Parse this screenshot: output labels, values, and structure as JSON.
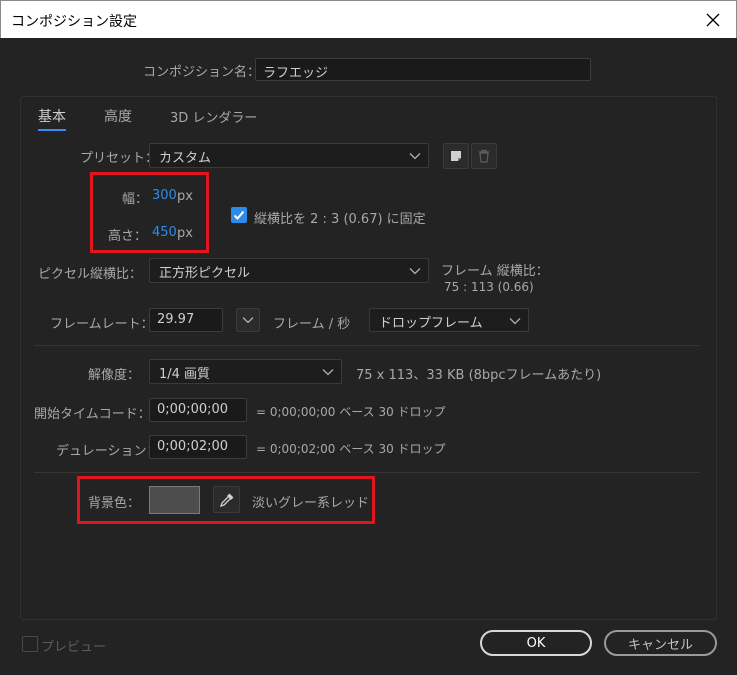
{
  "window": {
    "title": "コンポジション設定"
  },
  "comp_name": {
    "label": "コンポジション名：",
    "value": "ラフエッジ"
  },
  "tabs": [
    {
      "label": "基本",
      "active": true
    },
    {
      "label": "高度"
    },
    {
      "label": "3D レンダラー"
    }
  ],
  "preset": {
    "label": "プリセット：",
    "value": "カスタム"
  },
  "width": {
    "label": "幅：",
    "value": "300",
    "unit": "px"
  },
  "height": {
    "label": "高さ：",
    "value": "450",
    "unit": "px"
  },
  "aspect_lock": {
    "label": "縦横比を 2 : 3 (0.67) に固定",
    "checked": true
  },
  "pixel_aspect": {
    "label": "ピクセル縦横比：",
    "value": "正方形ピクセル"
  },
  "frame_aspect": {
    "label": "フレーム 縦横比：",
    "value": "75 : 113 (0.66)"
  },
  "frame_rate": {
    "label": "フレームレート：",
    "value": "29.97",
    "unit": "フレーム / 秒",
    "mode": "ドロップフレーム"
  },
  "resolution": {
    "label": "解像度：",
    "value": "1/4 画質",
    "info": "75 x 113、33 KB (8bpcフレームあたり)"
  },
  "start_timecode": {
    "label": "開始タイムコード：",
    "value": "0;00;00;00",
    "info": "= 0;00;00;00 ベース 30 ドロップ"
  },
  "duration": {
    "label": "デュレーション：",
    "value": "0;00;02;00",
    "info": "= 0;00;02;00 ベース 30 ドロップ"
  },
  "background": {
    "label": "背景色：",
    "color": "#4d4d4d",
    "name": "淡いグレー系レッド"
  },
  "preview": {
    "label": "プレビュー"
  },
  "buttons": {
    "ok": "OK",
    "cancel": "キャンセル"
  },
  "colors": {
    "accent": "#2d8ceb",
    "highlight": "#e2141c",
    "background": "#232323"
  }
}
